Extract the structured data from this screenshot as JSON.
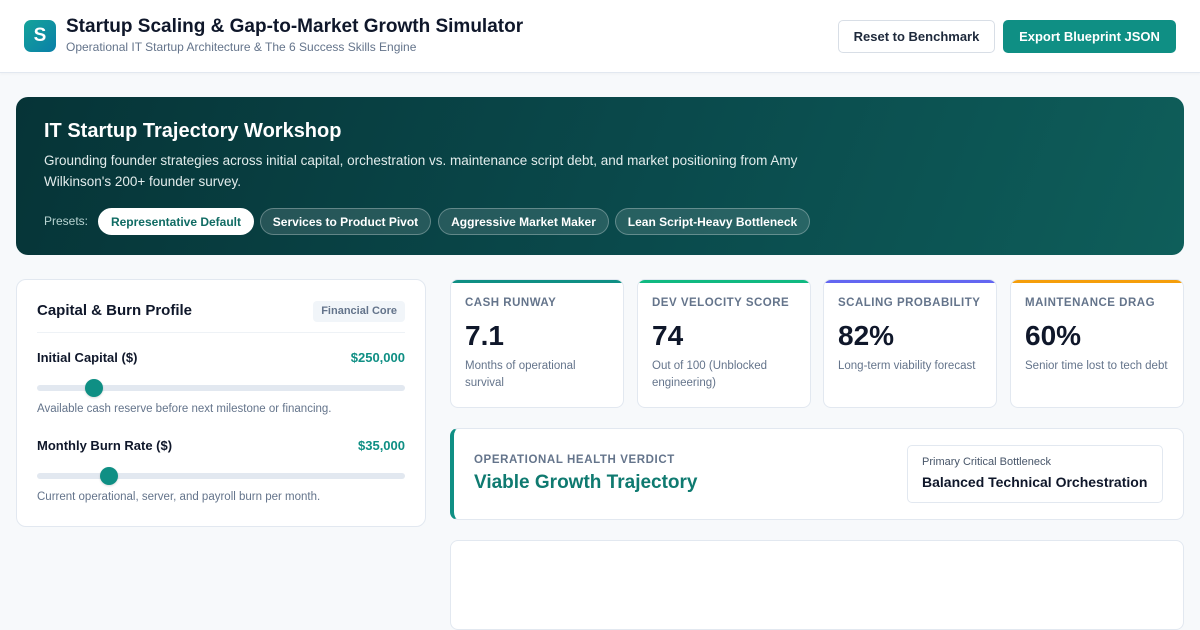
{
  "header": {
    "logo_letter": "S",
    "title": "Startup Scaling & Gap-to-Market Growth Simulator",
    "subtitle": "Operational IT Startup Architecture & The 6 Success Skills Engine",
    "reset_label": "Reset to Benchmark",
    "export_label": "Export Blueprint JSON"
  },
  "hero": {
    "title": "IT Startup Trajectory Workshop",
    "description": "Grounding founder strategies across initial capital, orchestration vs. maintenance script debt, and market positioning from Amy Wilkinson's 200+ founder survey.",
    "presets_label": "Presets:",
    "presets": [
      {
        "label": "Representative Default",
        "active": true
      },
      {
        "label": "Services to Product Pivot",
        "active": false
      },
      {
        "label": "Aggressive Market Maker",
        "active": false
      },
      {
        "label": "Lean Script-Heavy Bottleneck",
        "active": false
      }
    ]
  },
  "capital_panel": {
    "title": "Capital & Burn Profile",
    "tag": "Financial Core",
    "initial_capital": {
      "label": "Initial Capital ($)",
      "value": "$250,000",
      "slider_fraction": 0.155,
      "help": "Available cash reserve before next milestone or financing."
    },
    "monthly_burn": {
      "label": "Monthly Burn Rate ($)",
      "value": "$35,000",
      "slider_fraction": 0.195,
      "help": "Current operational, server, and payroll burn per month."
    }
  },
  "metrics": [
    {
      "label": "CASH RUNWAY",
      "value": "7.1",
      "description": "Months of operational survival",
      "accent": "#0f8f84"
    },
    {
      "label": "DEV VELOCITY SCORE",
      "value": "74",
      "description": "Out of 100 (Unblocked engineering)",
      "accent": "#10b981"
    },
    {
      "label": "SCALING PROBABILITY",
      "value": "82%",
      "description": "Long-term viability forecast",
      "accent": "#6366f1"
    },
    {
      "label": "MAINTENANCE DRAG",
      "value": "60%",
      "description": "Senior time lost to tech debt",
      "accent": "#f59e0b"
    }
  ],
  "verdict": {
    "label": "OPERATIONAL HEALTH VERDICT",
    "value": "Viable Growth Trajectory",
    "bottleneck_label": "Primary Critical Bottleneck",
    "bottleneck_value": "Balanced Technical Orchestration"
  }
}
